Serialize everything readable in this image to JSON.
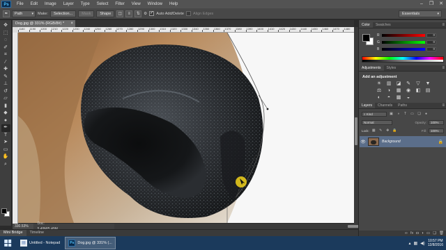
{
  "app": {
    "logo": "Ps",
    "menu": [
      "File",
      "Edit",
      "Image",
      "Layer",
      "Type",
      "Select",
      "Filter",
      "View",
      "Window",
      "Help"
    ],
    "window_controls": [
      "–",
      "❐",
      "✕"
    ]
  },
  "options_bar": {
    "mode_value": "Path",
    "make_label": "Make:",
    "selection_button": "Selection...",
    "mask_button": "Mask",
    "shape_button": "Shape",
    "auto_add_delete_label": "Auto Add/Delete",
    "auto_add_delete_checked": true,
    "align_edges_label": "Align Edges",
    "align_edges_checked": false,
    "workspace": "Essentials"
  },
  "document": {
    "tab_title": "Dog.jpg @ 331% (RGB/8#) *",
    "ruler_ticks": [
      "1180",
      "1190",
      "1200",
      "1210",
      "1220",
      "1230",
      "1240",
      "1250",
      "1260",
      "1270",
      "1280",
      "1290",
      "1300",
      "1310",
      "1320",
      "1330",
      "1340",
      "1350",
      "1360",
      "1370",
      "1380",
      "1390",
      "1400",
      "1410",
      "1420",
      "1430",
      "1440",
      "1450",
      "1460",
      "1470",
      "1480"
    ],
    "zoom": "330.53%",
    "doc_info": "Doc: 5.49M/5.49M"
  },
  "bottom_tabs": [
    "Mini Bridge",
    "Timeline"
  ],
  "panels": {
    "color": {
      "tabs": [
        "Color",
        "Swatches"
      ],
      "sliders": [
        {
          "label": "R",
          "value": "0",
          "color": "#ff0000"
        },
        {
          "label": "G",
          "value": "0",
          "color": "#00ff00"
        },
        {
          "label": "B",
          "value": "0",
          "color": "#0000ff"
        }
      ]
    },
    "adjustments": {
      "tabs": [
        "Adjustments",
        "Styles"
      ],
      "title": "Add an adjustment",
      "icons": [
        "☀",
        "▥",
        "◪",
        "✎",
        "▽",
        "▼",
        "⚖",
        "◑",
        "▦",
        "◉",
        "◧",
        "▤",
        "◐",
        "◓",
        "▩",
        "◒",
        "▣",
        "▧"
      ]
    },
    "layers": {
      "tabs": [
        "Layers",
        "Channels",
        "Paths"
      ],
      "filter_label": "Kind",
      "blend_mode": "Normal",
      "opacity_label": "Opacity:",
      "opacity_value": "100%",
      "lock_label": "Lock:",
      "fill_label": "Fill:",
      "fill_value": "100%",
      "layer_name": "Background",
      "bottom_icons": [
        "∞",
        "fx",
        "◘",
        "◑",
        "▭",
        "❏",
        "🗑"
      ]
    }
  },
  "taskbar": {
    "tasks": [
      {
        "label": "Untitled - Notepad",
        "icon": "notepad-icon"
      },
      {
        "label": "Dog.jpg @ 331% (...",
        "icon": "photoshop-icon"
      }
    ],
    "time": "10:57 PM",
    "date": "12/8/2016"
  },
  "colors": {
    "menu_bg": "#535353",
    "panel_bg": "#474747",
    "selected_layer": "#5b6e8a",
    "taskbar_bg": "#1b3a5c"
  }
}
